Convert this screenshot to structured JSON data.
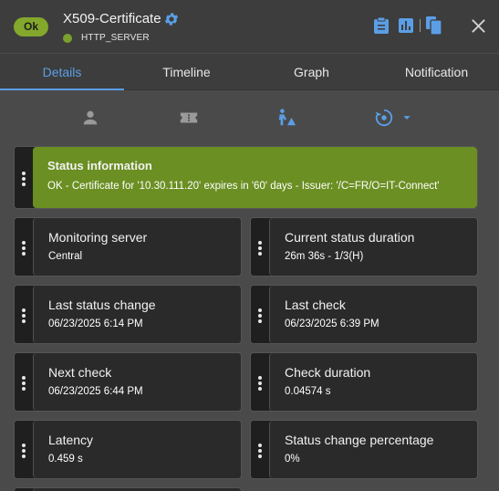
{
  "header": {
    "status_badge": "Ok",
    "title": "X509-Certificate",
    "subtitle": "HTTP_SERVER"
  },
  "tabs": [
    {
      "label": "Details",
      "active": true
    },
    {
      "label": "Timeline",
      "active": false
    },
    {
      "label": "Graph",
      "active": false
    },
    {
      "label": "Notification",
      "active": false
    }
  ],
  "subtabs": [
    "person-icon",
    "ticket-icon",
    "maintenance-icon",
    "acknowledge-icon"
  ],
  "status_info": {
    "label": "Status information",
    "value": "OK - Certificate for '10.30.111.20' expires in '60' days - Issuer: '/C=FR/O=IT-Connect'"
  },
  "details": [
    {
      "label": "Monitoring server",
      "value": "Central"
    },
    {
      "label": "Current status duration",
      "value": "26m 36s - 1/3(H)"
    },
    {
      "label": "Last status change",
      "value": "06/23/2025 6:14 PM"
    },
    {
      "label": "Last check",
      "value": "06/23/2025 6:39 PM"
    },
    {
      "label": "Next check",
      "value": "06/23/2025 6:44 PM"
    },
    {
      "label": "Check duration",
      "value": "0.04574 s"
    },
    {
      "label": "Latency",
      "value": "0.459 s"
    },
    {
      "label": "Status change percentage",
      "value": "0%"
    }
  ],
  "colors": {
    "accent": "#5b9ee6",
    "status_ok": "#84a82b",
    "status_banner": "#6b8f23"
  }
}
